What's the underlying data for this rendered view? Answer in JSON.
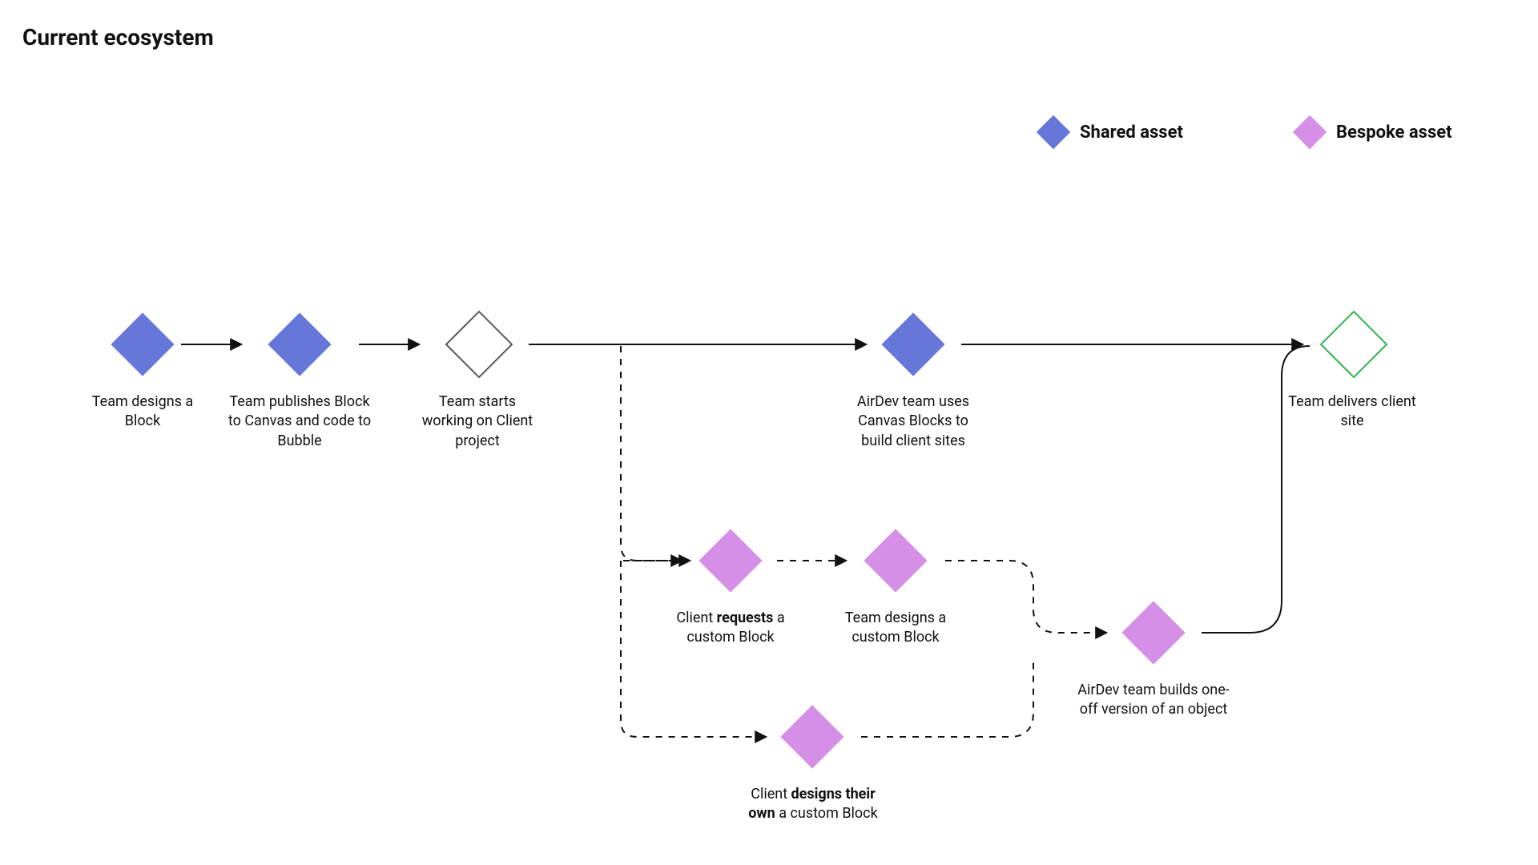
{
  "title": "Current ecosystem",
  "legend": {
    "shared": "Shared asset",
    "bespoke": "Bespoke asset"
  },
  "nodes": {
    "n1": "Team designs a Block",
    "n2": "Team publishes Block to Canvas and code to Bubble",
    "n3": "Team starts working on Client project",
    "n4": "AirDev team uses Canvas Blocks to build client sites",
    "n5": "Team delivers client site",
    "n6_pre": "Client ",
    "n6_b": "requests",
    "n6_post": " a custom Block",
    "n7": "Team designs a custom Block",
    "n8_pre": "Client ",
    "n8_b": "designs their own",
    "n8_post": " a custom Block",
    "n9": "AirDev team builds one-off version of an object"
  },
  "colors": {
    "shared": "#6677d9",
    "bespoke": "#d58fe6",
    "delivery": "#2fb24c"
  }
}
